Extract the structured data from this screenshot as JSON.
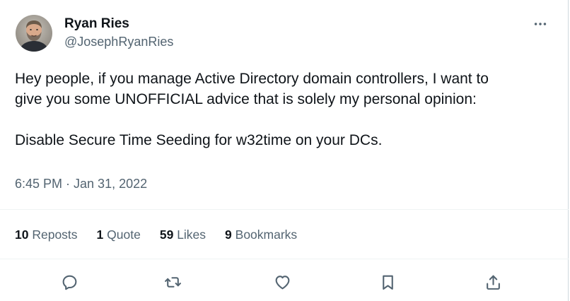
{
  "author": {
    "display_name": "Ryan Ries",
    "handle": "@JosephRyanRies",
    "avatar_icon": "avatar-photo"
  },
  "tweet": {
    "paragraph1": "Hey people, if you manage Active Directory domain controllers, I want to\ngive you some UNOFFICIAL advice that is solely my personal opinion:",
    "paragraph2": "Disable Secure Time Seeding for w32time on your DCs.",
    "timestamp": "6:45 PM · Jan 31, 2022"
  },
  "stats": {
    "reposts_count": "10",
    "reposts_label": "Reposts",
    "quotes_count": "1",
    "quotes_label": "Quote",
    "likes_count": "59",
    "likes_label": "Likes",
    "bookmarks_count": "9",
    "bookmarks_label": "Bookmarks"
  },
  "actions": {
    "reply_icon": "reply-icon",
    "repost_icon": "repost-icon",
    "like_icon": "heart-icon",
    "bookmark_icon": "bookmark-icon",
    "share_icon": "share-icon",
    "more_icon": "more-options-icon"
  },
  "colors": {
    "text_primary": "#0f1419",
    "text_secondary": "#536471",
    "divider": "#eff3f4"
  }
}
